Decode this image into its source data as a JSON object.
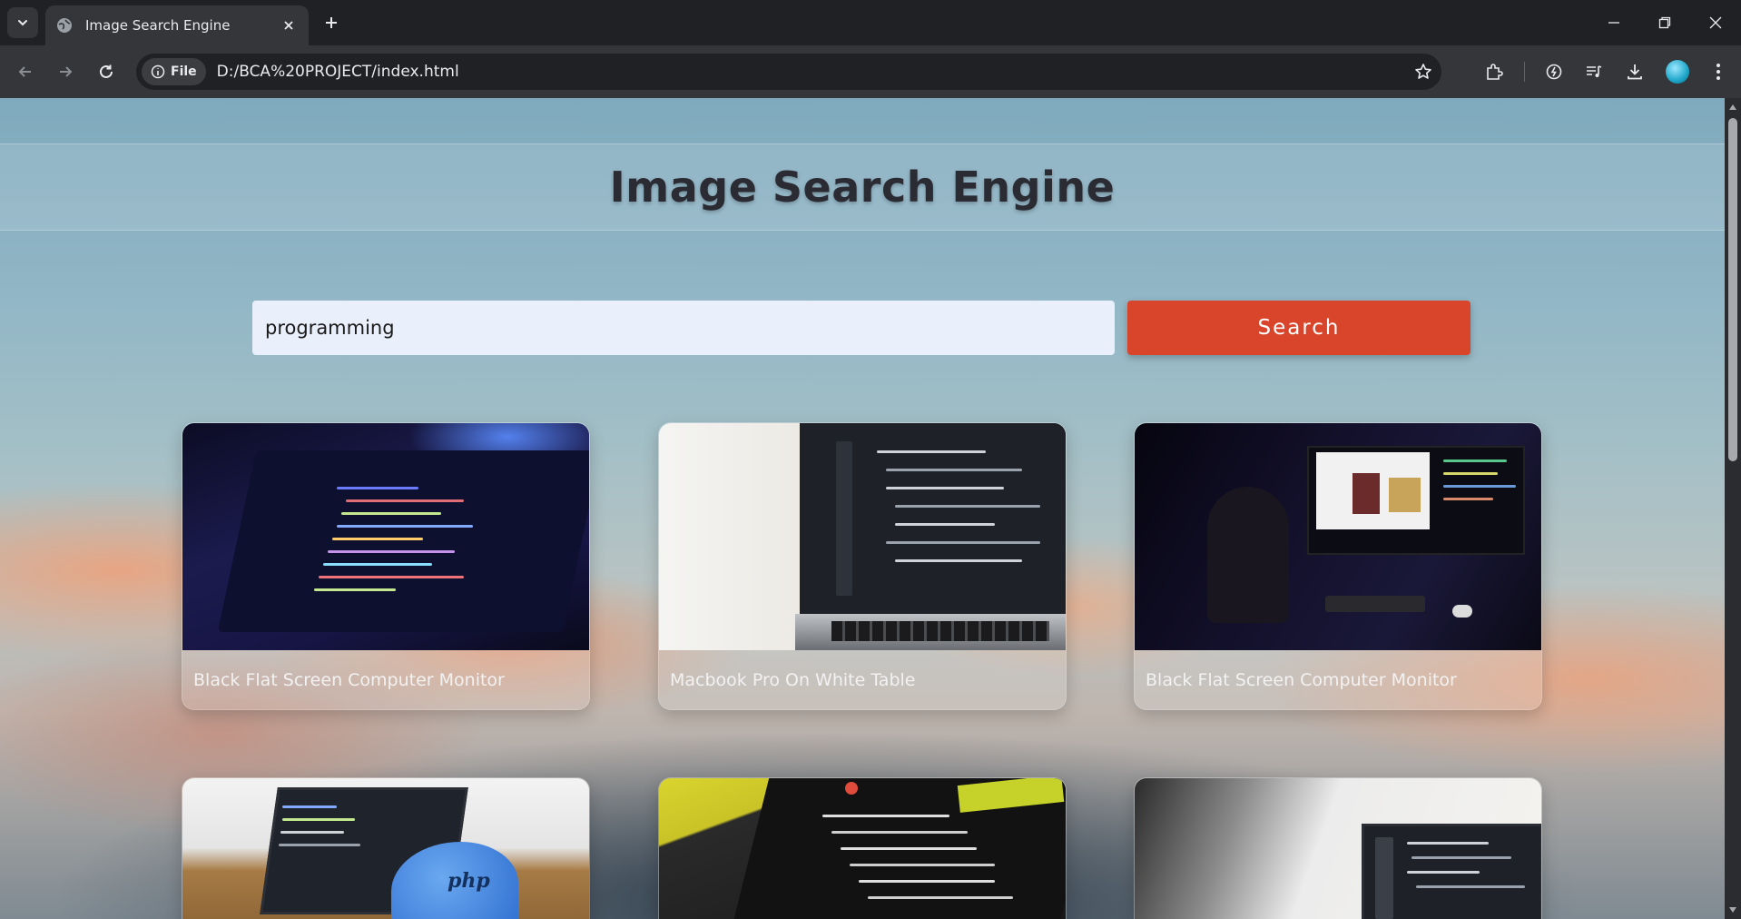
{
  "browser": {
    "tab_title": "Image Search Engine",
    "url_scheme_chip": "File",
    "url": "D:/BCA%20PROJECT/index.html"
  },
  "page": {
    "title": "Image Search Engine",
    "search_value": "programming",
    "search_button": "Search"
  },
  "results": [
    {
      "caption": "Black Flat Screen Computer Monitor",
      "thumbnail": "laptop-code-dark-blue"
    },
    {
      "caption": "Macbook Pro On White Table",
      "thumbnail": "laptop-code-white-table"
    },
    {
      "caption": "Black Flat Screen Computer Monitor",
      "thumbnail": "monitor-person-dark"
    },
    {
      "caption": "",
      "thumbnail": "laptop-php-elephant"
    },
    {
      "caption": "",
      "thumbnail": "screen-terminal-yellow-note"
    },
    {
      "caption": "",
      "thumbnail": "laptop-shadow-wall"
    }
  ],
  "colors": {
    "accent": "#d8452b",
    "input_bg": "#e9effb",
    "title": "#2b2b33"
  },
  "icons": [
    "tab-search-icon",
    "globe-icon",
    "close-icon",
    "plus-icon",
    "minimize-icon",
    "restore-icon",
    "window-close-icon",
    "back-icon",
    "forward-icon",
    "reload-icon",
    "info-icon",
    "star-icon",
    "extensions-icon",
    "performance-icon",
    "media-icon",
    "download-icon",
    "profile-avatar",
    "menu-icon"
  ]
}
